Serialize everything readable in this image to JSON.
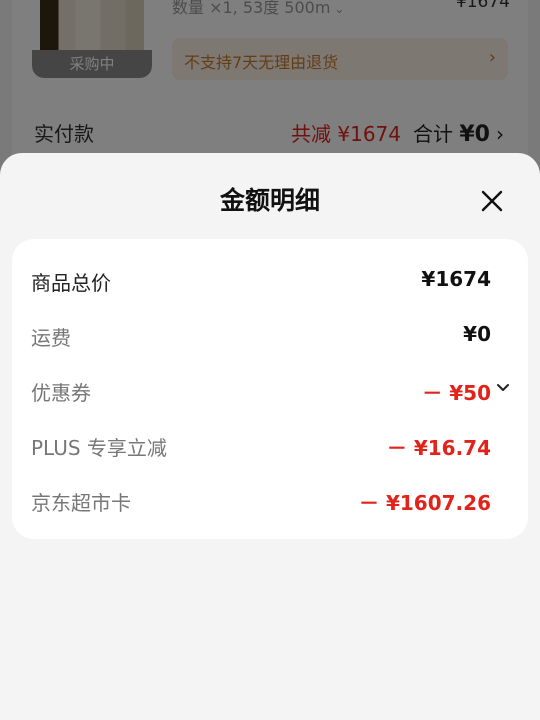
{
  "background": {
    "product_badge": "采购中",
    "spec": "数量 ×1, 53度 500m",
    "price": "¥1674",
    "notice": "不支持7天无理由退货",
    "pay_label": "实付款",
    "reduce": "共减 ¥1674",
    "total_label": "合计",
    "total_value": "¥0"
  },
  "sheet": {
    "title": "金额明细",
    "rows": [
      {
        "label": "商品总价",
        "value": "¥1674"
      },
      {
        "label": "运费",
        "value": "¥0"
      },
      {
        "label": "优惠券",
        "value": "－ ¥50"
      },
      {
        "label": "PLUS 专享立减",
        "value": "－ ¥16.74"
      },
      {
        "label": "京东超市卡",
        "value": "－ ¥1607.26"
      }
    ]
  },
  "colors": {
    "accent_red": "#e2231a",
    "sheet_bg": "#f4f4f4",
    "card_bg": "#ffffff"
  }
}
